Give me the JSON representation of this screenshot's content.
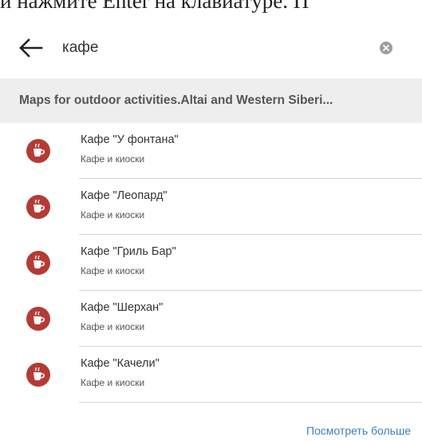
{
  "header_fragment": "и нажмите Enter на клавиатуре. П",
  "search": {
    "query": "кафе",
    "back_icon": "arrow-left-icon",
    "clear_icon": "clear-circle-icon"
  },
  "section": {
    "title": "Maps for outdoor activities.Altai and Western Siberi..."
  },
  "results": [
    {
      "title": "Кафе \"У фонтана\"",
      "subtitle": "Кафе и киоски",
      "icon": "coffee-cup-icon"
    },
    {
      "title": "Кафе \"Леопард\"",
      "subtitle": "Кафе и киоски",
      "icon": "coffee-cup-icon"
    },
    {
      "title": "Кафе \"Гриль Бар\"",
      "subtitle": "Кафе и киоски",
      "icon": "coffee-cup-icon"
    },
    {
      "title": "Кафе \"Шерхан\"",
      "subtitle": "Кафе и киоски",
      "icon": "coffee-cup-icon"
    },
    {
      "title": "Кафе \"Качели\"",
      "subtitle": "Кафе и киоски",
      "icon": "coffee-cup-icon"
    }
  ],
  "see_more_label": "Посмотреть больше",
  "colors": {
    "accent": "#3a7ec2",
    "icon_bg": "#b33b36",
    "section_bg": "#eeeeee"
  }
}
